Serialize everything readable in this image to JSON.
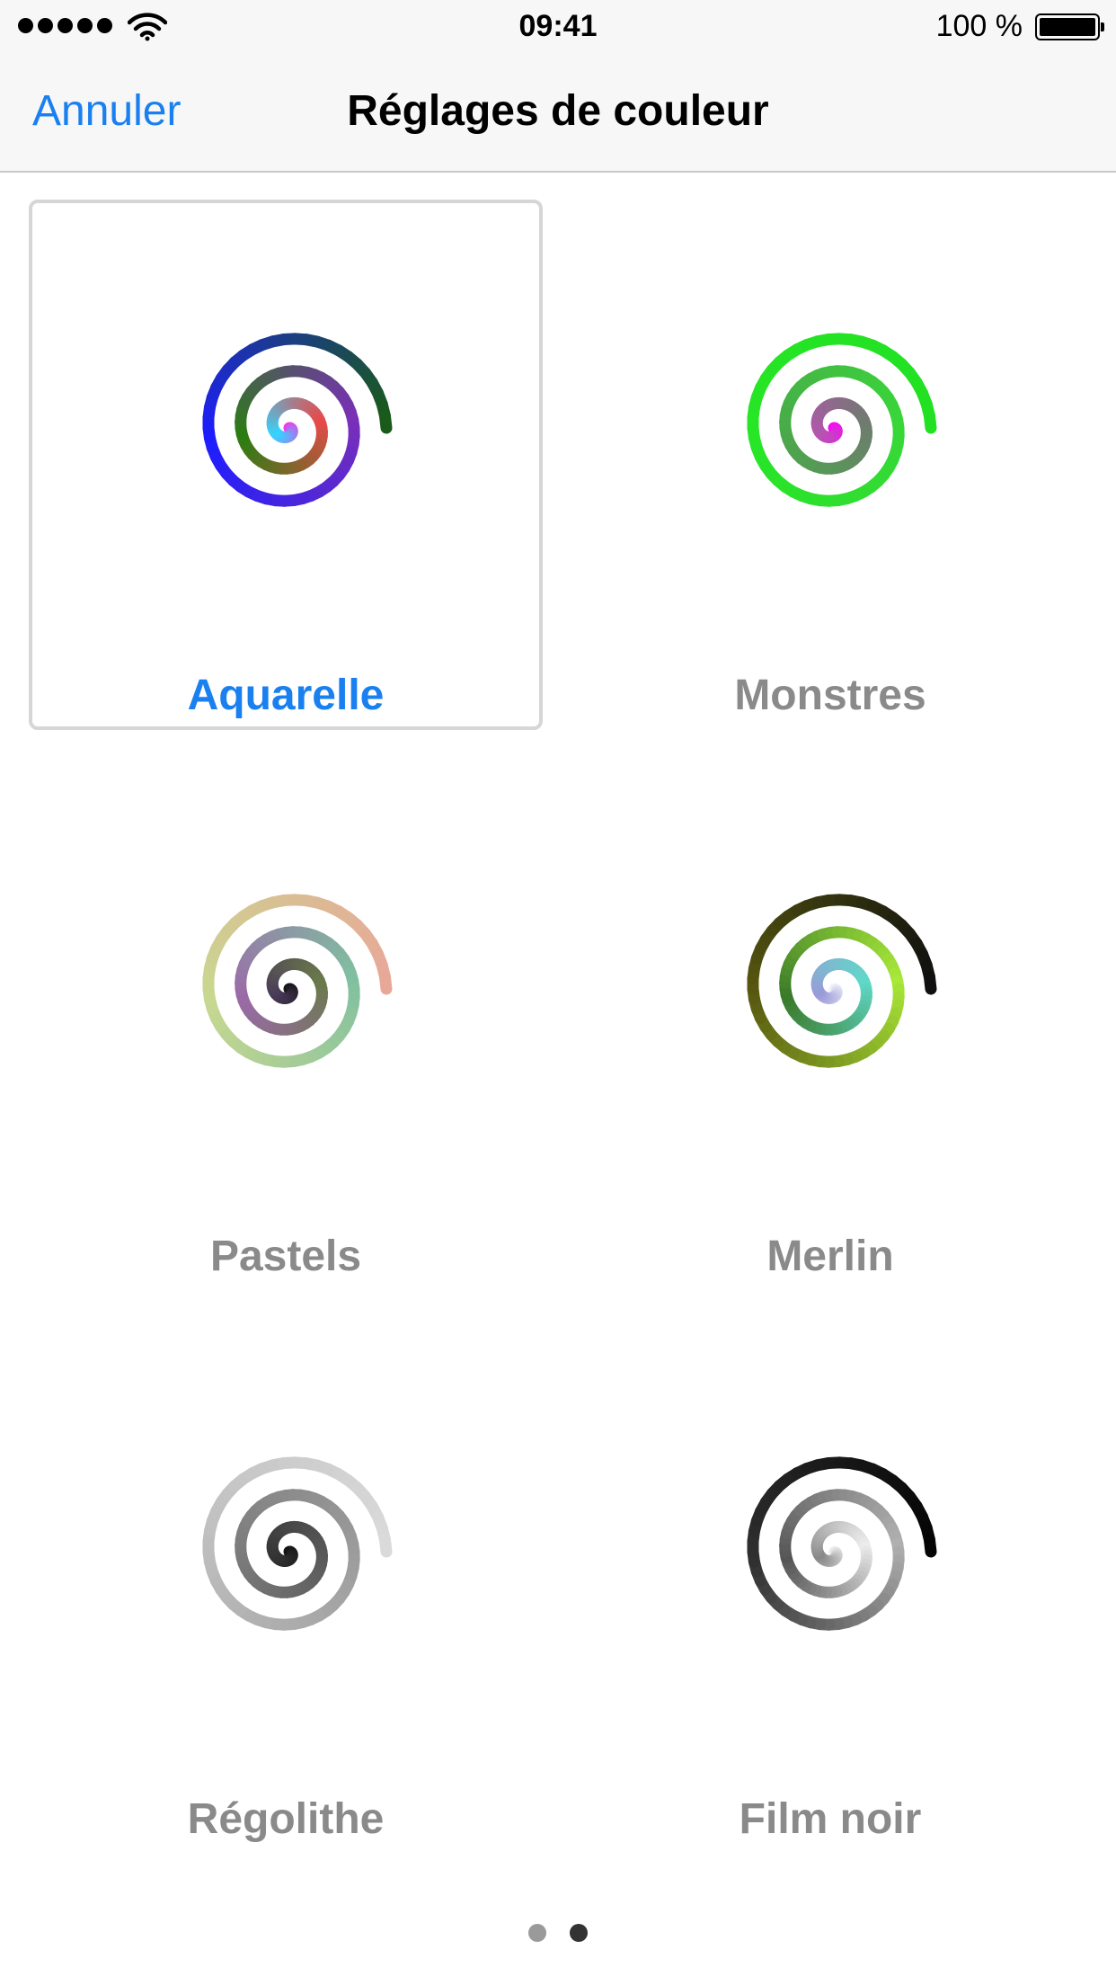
{
  "status": {
    "time": "09:41",
    "battery": "100 %",
    "signal_icon": "signal-dots-icon",
    "wifi_icon": "wifi-icon",
    "battery_icon": "battery-icon"
  },
  "nav": {
    "cancel_label": "Annuler",
    "title": "Réglages de couleur"
  },
  "accent_color": "#1a80f0",
  "palettes": [
    {
      "label": "Aquarelle",
      "selected": true,
      "colors": [
        "#ff2ee6",
        "#32d6ff",
        "#e84a4a",
        "#2a7d12",
        "#7a2fb8",
        "#1d1dff",
        "#1a5a1a"
      ]
    },
    {
      "label": "Monstres",
      "selected": false,
      "colors": [
        "#ff00ff",
        "#b555b0",
        "#707a70",
        "#4aa84a",
        "#39d639",
        "#26e626",
        "#22e022"
      ]
    },
    {
      "label": "Pastels",
      "selected": false,
      "colors": [
        "#111111",
        "#4a3a5a",
        "#6a7a4a",
        "#9a6aa8",
        "#80c0a0",
        "#c8d890",
        "#e8a898"
      ]
    },
    {
      "label": "Merlin",
      "selected": false,
      "colors": [
        "#ffffff",
        "#9a9ad8",
        "#60d8c8",
        "#3a7a2a",
        "#a8e838",
        "#5a5a10",
        "#101010"
      ]
    },
    {
      "label": "Régolithe",
      "selected": false,
      "colors": [
        "#111111",
        "#333333",
        "#555555",
        "#7a7a7a",
        "#9a9a9a",
        "#bcbcbc",
        "#dadada"
      ]
    },
    {
      "label": "Film noir",
      "selected": false,
      "colors": [
        "#ffffff",
        "#888888",
        "#ececec",
        "#555555",
        "#b0b0b0",
        "#303030",
        "#050505"
      ]
    }
  ],
  "pager": {
    "pages": 2,
    "current": 2
  }
}
